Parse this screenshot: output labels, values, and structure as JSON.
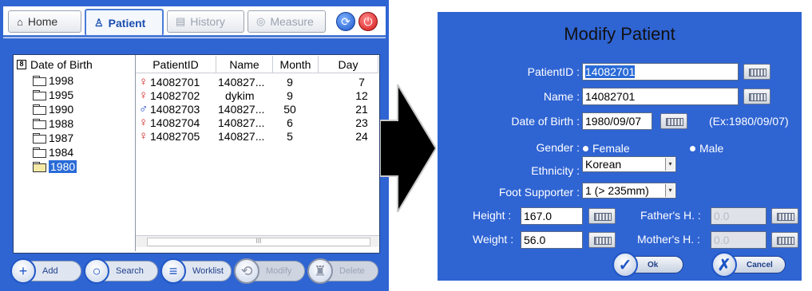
{
  "tabs": [
    {
      "label": "Home",
      "icon": "home-icon",
      "glyph": "⌂"
    },
    {
      "label": "Patient",
      "icon": "patient-icon",
      "glyph": "♙"
    },
    {
      "label": "History",
      "icon": "history-icon",
      "glyph": "▤"
    },
    {
      "label": "Measure",
      "icon": "measure-icon",
      "glyph": "◎"
    }
  ],
  "tree": {
    "root_label": "Date of Birth",
    "expander": "8",
    "items": [
      "1998",
      "1995",
      "1990",
      "1988",
      "1987",
      "1984",
      "1980"
    ],
    "selected": "1980"
  },
  "table": {
    "columns": [
      "PatientID",
      "Name",
      "Month",
      "Day"
    ],
    "rows": [
      {
        "gender": "♀",
        "id": "14082701",
        "name": "140827...",
        "month": "9",
        "day": "7"
      },
      {
        "gender": "♀",
        "id": "14082702",
        "name": "dykim",
        "month": "9",
        "day": "12"
      },
      {
        "gender": "♂",
        "id": "14082703",
        "name": "140827...",
        "month": "50",
        "day": "21"
      },
      {
        "gender": "♀",
        "id": "14082704",
        "name": "140827...",
        "month": "6",
        "day": "23"
      },
      {
        "gender": "♀",
        "id": "14082705",
        "name": "140827...",
        "month": "5",
        "day": "24"
      }
    ],
    "scroll_thumb": "III"
  },
  "bottom_buttons": {
    "add": "Add",
    "search": "Search",
    "worklist": "Worklist",
    "modify": "Modify",
    "delete": "Delete"
  },
  "dialog": {
    "title": "Modify Patient",
    "patient_id_label": "PatientID :",
    "patient_id_value": "14082701",
    "name_label": "Name :",
    "name_value": "14082701",
    "dob_label": "Date of Birth :",
    "dob_value": "1980/09/07",
    "dob_hint": "(Ex:1980/09/07)",
    "gender_label": "Gender :",
    "gender_female": "Female",
    "gender_male": "Male",
    "ethnicity_label": "Ethnicity :",
    "ethnicity_value": "Korean",
    "foot_label": "Foot Supporter :",
    "foot_value": "1 (> 235mm)",
    "height_label": "Height :",
    "height_value": "167.0",
    "weight_label": "Weight :",
    "weight_value": "56.0",
    "father_label": "Father's H. :",
    "father_value": "0.0",
    "mother_label": "Mother's H. :",
    "mother_value": "0.0",
    "ok": "Ok",
    "cancel": "Cancel"
  },
  "colors": {
    "panel_blue": "#2f64d3",
    "female": "#d01818",
    "male": "#1a3fd0",
    "selection": "#2a6bd7"
  }
}
